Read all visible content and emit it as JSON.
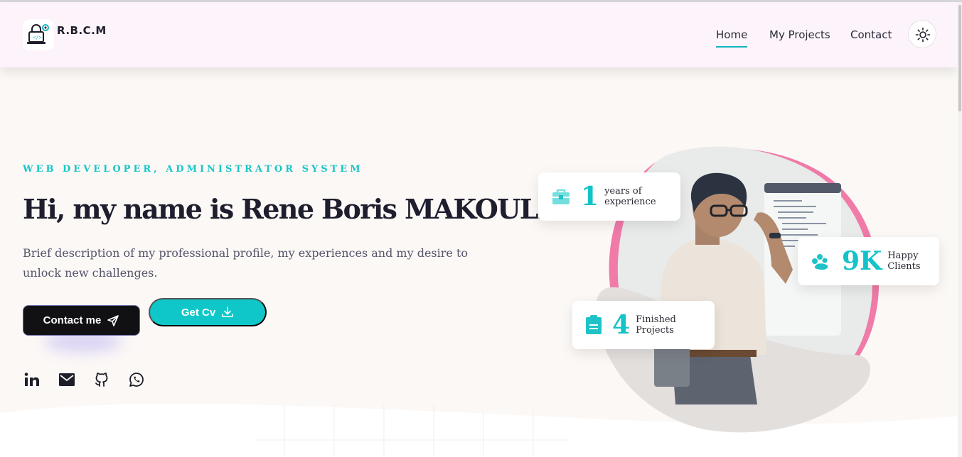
{
  "brand": {
    "name": "R.B.C.M"
  },
  "nav": {
    "home": "Home",
    "projects": "My Projects",
    "contact": "Contact"
  },
  "hero": {
    "subtitle": "WEB DEVELOPER, ADMINISTRATOR SYSTEM",
    "headline": "Hi, my name is Rene Boris MAKOULE",
    "description": "Brief description of my professional profile, my experiences and my desire to unlock new challenges.",
    "contact_label": "Contact me",
    "cv_label": "Get Cv"
  },
  "social": [
    "linkedin-icon",
    "mail-icon",
    "github-icon",
    "whatsapp-icon"
  ],
  "stats": {
    "experience": {
      "value": "1",
      "label": "years of\nexperience",
      "icon": "briefcase-icon"
    },
    "clients": {
      "value": "9K",
      "label": "Happy\nClients",
      "icon": "clients-icon"
    },
    "projects": {
      "value": "4",
      "label": "Finished\nProjects",
      "icon": "clipboard-icon"
    }
  },
  "colors": {
    "accent": "#0fc7c9",
    "dark": "#111114",
    "pink": "#ef6fa6",
    "navbar": "#fdf3fb",
    "background": "#fcf8f6"
  }
}
